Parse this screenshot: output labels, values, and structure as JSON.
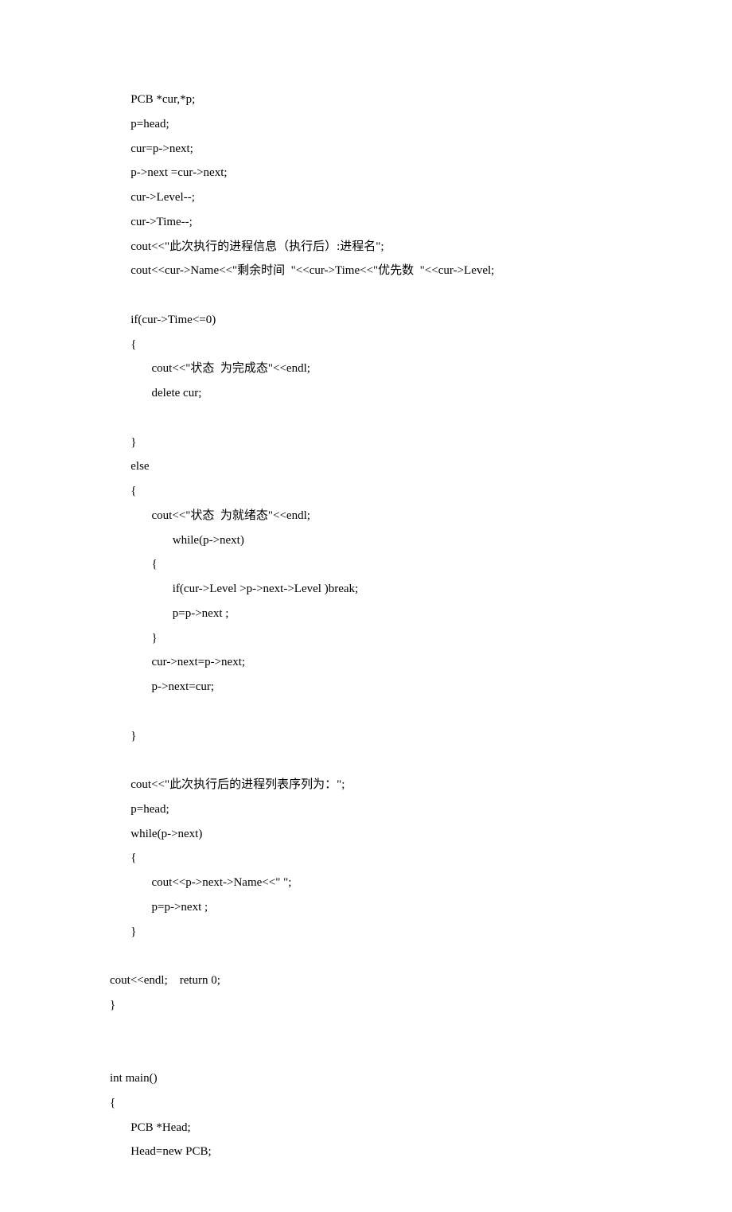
{
  "code": {
    "lines": [
      "       PCB *cur,*p;",
      "       p=head;",
      "       cur=p->next;",
      "       p->next =cur->next;",
      "       cur->Level--;",
      "       cur->Time--;",
      "       cout<<\"此次执行的进程信息（执行后）:进程名\";",
      "       cout<<cur->Name<<\"剩余时间  \"<<cur->Time<<\"优先数  \"<<cur->Level;",
      "",
      "       if(cur->Time<=0)",
      "       {",
      "              cout<<\"状态  为完成态\"<<endl;",
      "              delete cur;",
      "",
      "       }",
      "       else",
      "       {",
      "              cout<<\"状态  为就绪态\"<<endl;",
      "                     while(p->next)",
      "              {",
      "                     if(cur->Level >p->next->Level )break;",
      "                     p=p->next ;",
      "              }",
      "              cur->next=p->next;",
      "              p->next=cur;",
      "",
      "       }",
      "",
      "       cout<<\"此次执行后的进程列表序列为：\";",
      "       p=head;",
      "       while(p->next)",
      "       {",
      "              cout<<p->next->Name<<\" \";",
      "              p=p->next ;",
      "       }",
      "",
      "cout<<endl;    return 0;",
      "}",
      "",
      "",
      "int main()",
      "{",
      "       PCB *Head;",
      "       Head=new PCB;"
    ]
  }
}
